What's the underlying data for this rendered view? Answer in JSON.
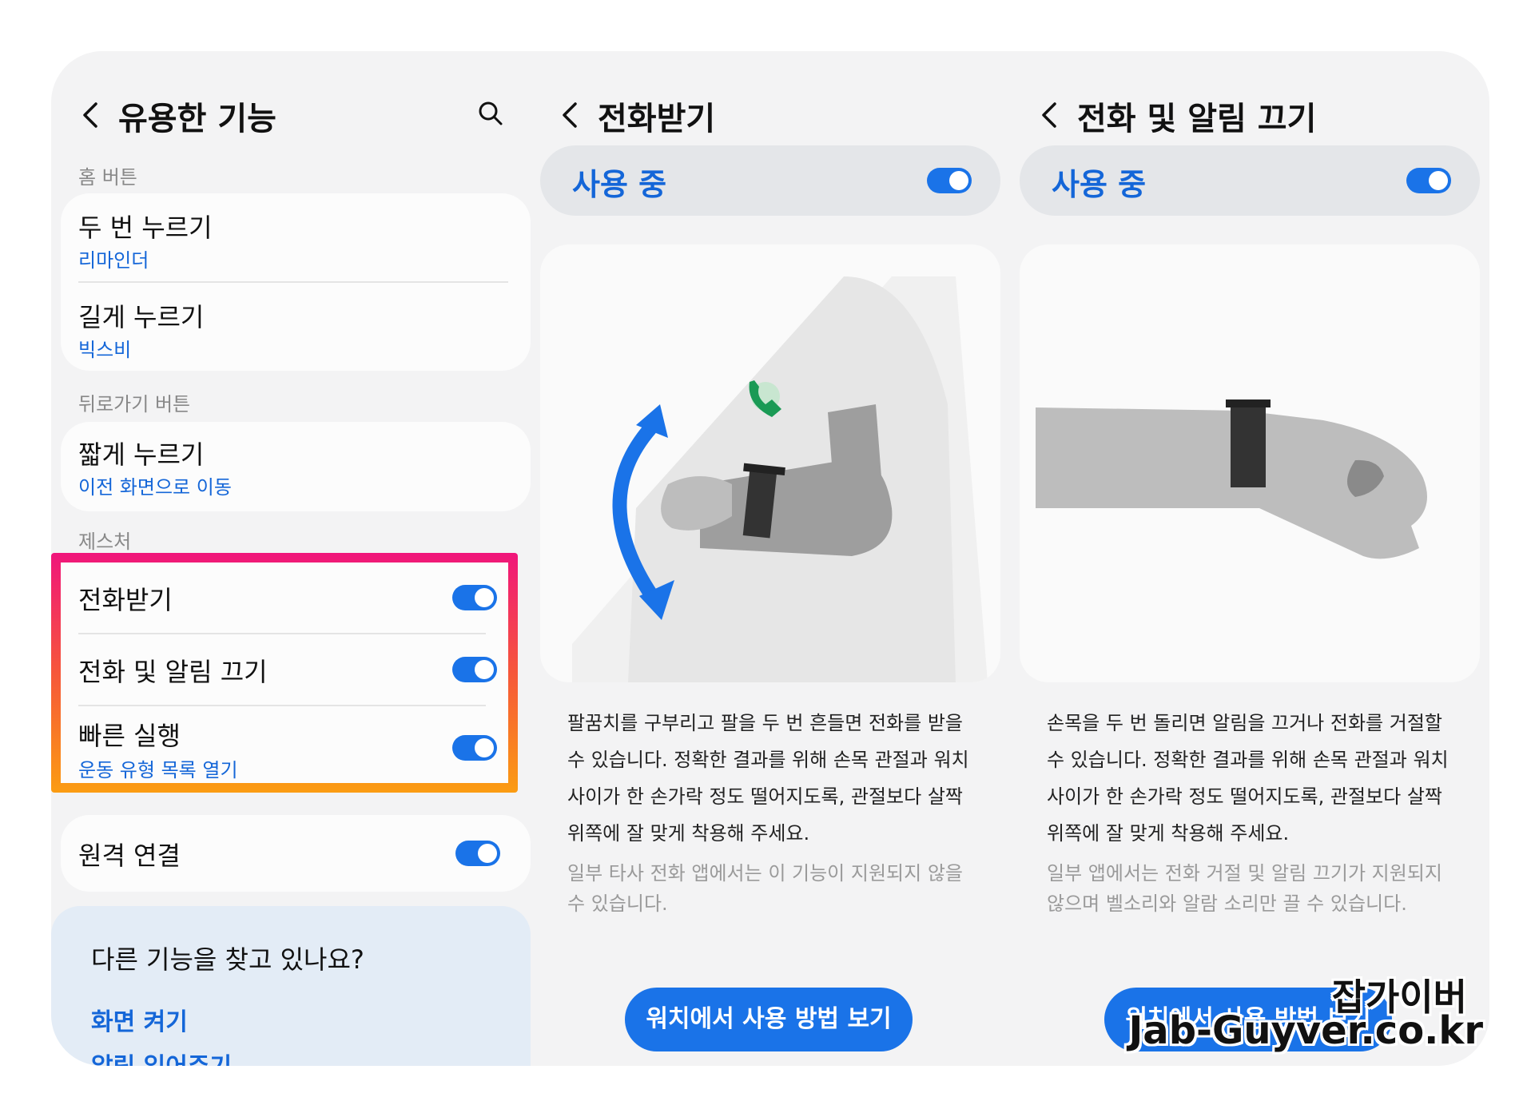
{
  "colors": {
    "accent": "#1a73e8",
    "highlight_top": "#f0157b",
    "highlight_bottom": "#fb9c12"
  },
  "panel1": {
    "title": "유용한 기능",
    "sections": {
      "home": "홈 버튼",
      "back": "뒤로가기 버튼",
      "gesture": "제스처"
    },
    "double_press": {
      "title": "두 번 누르기",
      "sub": "리마인더"
    },
    "long_press": {
      "title": "길게 누르기",
      "sub": "빅스비"
    },
    "short_press": {
      "title": "짧게 누르기",
      "sub": "이전 화면으로 이동"
    },
    "gestures": {
      "answer_call": {
        "title": "전화받기",
        "enabled": true
      },
      "mute_call": {
        "title": "전화 및 알림 끄기",
        "enabled": true
      },
      "quick_launch": {
        "title": "빠른 실행",
        "sub": "운동 유형 목록 열기",
        "enabled": true
      }
    },
    "remote": {
      "title": "원격 연결",
      "enabled": true
    },
    "suggest": {
      "question": "다른 기능을 찾고 있나요?",
      "link1": "화면 켜기",
      "link2": "알림 읽어주기"
    }
  },
  "panel2": {
    "title": "전화받기",
    "master_label": "사용 중",
    "enabled": true,
    "description": "팔꿈치를 구부리고 팔을 두 번 흔들면 전화를 받을 수 있습니다. 정확한 결과를 위해 손목 관절과 워치 사이가 한 손가락 정도 떨어지도록, 관절보다 살짝 위쪽에 잘 맞게 착용해 주세요.",
    "note": "일부 타사 전화 앱에서는 이 기능이 지원되지 않을 수 있습니다.",
    "button": "워치에서 사용 방법 보기"
  },
  "panel3": {
    "title": "전화 및 알림 끄기",
    "master_label": "사용 중",
    "enabled": true,
    "description": "손목을 두 번 돌리면 알림을 끄거나 전화를 거절할 수 있습니다. 정확한 결과를 위해 손목 관절과 워치 사이가 한 손가락 정도 떨어지도록, 관절보다 살짝 위쪽에 잘 맞게 착용해 주세요.",
    "note": "일부 앱에서는 전화 거절 및 알림 끄기가 지원되지 않으며 벨소리와 알람 소리만 끌 수 있습니다.",
    "button": "워치에서 사용 방법 보기"
  },
  "watermark": {
    "line1": "잡가이버",
    "line2": "Jab-Guyver.co.kr"
  }
}
